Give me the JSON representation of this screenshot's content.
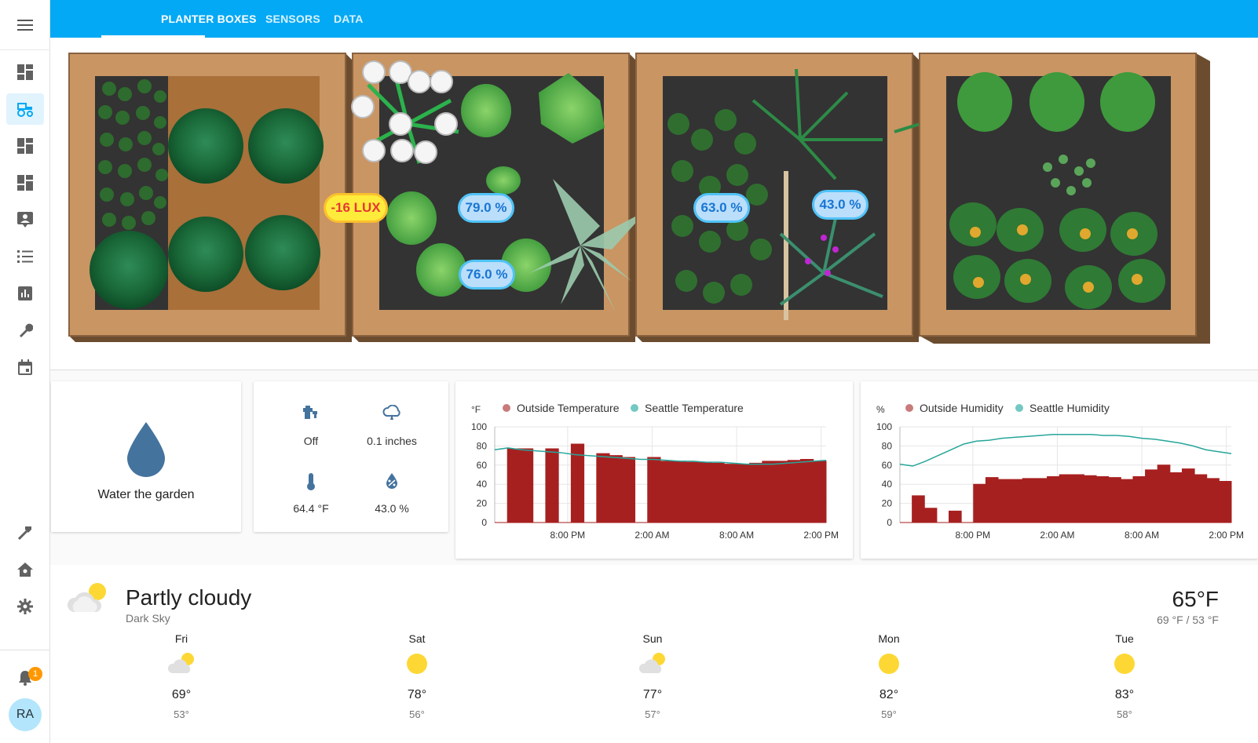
{
  "tabs": [
    {
      "label": "PLANTER BOXES",
      "active": true
    },
    {
      "label": "SENSORS",
      "active": false
    },
    {
      "label": "DATA",
      "active": false
    }
  ],
  "sidebar": {
    "items": [
      {
        "icon": "dashboard-icon"
      },
      {
        "icon": "tractor-icon",
        "active": true
      },
      {
        "icon": "dashboard-icon"
      },
      {
        "icon": "dashboard-icon"
      },
      {
        "icon": "account-box-icon"
      },
      {
        "icon": "list-icon"
      },
      {
        "icon": "chart-bar-icon"
      },
      {
        "icon": "wrench-icon"
      },
      {
        "icon": "calendar-icon"
      }
    ],
    "bottom_items": [
      {
        "icon": "hammer-icon"
      },
      {
        "icon": "home-assistant-icon"
      },
      {
        "icon": "gear-icon"
      }
    ],
    "notifications_count": "1",
    "user_initials": "RA"
  },
  "garden": {
    "sensors": {
      "lux": "-16 LUX",
      "moisture_1": "79.0 %",
      "moisture_2": "76.0 %",
      "moisture_3": "63.0 %",
      "moisture_4": "43.0 %"
    }
  },
  "water_card": {
    "label": "Water the garden"
  },
  "stats": {
    "valve": "Off",
    "rain": "0.1 inches",
    "temperature": "64.4 °F",
    "humidity": "43.0 %"
  },
  "chart_data": [
    {
      "type": "line",
      "ylabel": "°F",
      "ylim": [
        0,
        100
      ],
      "yticks": [
        "0",
        "20",
        "40",
        "60",
        "80",
        "100"
      ],
      "xticks": [
        "8:00 PM",
        "2:00 AM",
        "8:00 AM",
        "2:00 PM"
      ],
      "grid": true,
      "legend_position": "top-left",
      "series": [
        {
          "name": "Outside Temperature",
          "color": "#a31515",
          "values": [
            0,
            77,
            77,
            0,
            77,
            0,
            82,
            0,
            72,
            70,
            68,
            0,
            68,
            64,
            64,
            63,
            63,
            62,
            61,
            61,
            62,
            64,
            64,
            65,
            66,
            64
          ]
        },
        {
          "name": "Seattle Temperature",
          "color": "#26a69a",
          "values": [
            76,
            78,
            76,
            75,
            74,
            73,
            71,
            70,
            69,
            68,
            67,
            66,
            66,
            65,
            64,
            64,
            63,
            63,
            62,
            61,
            61,
            61,
            62,
            63,
            64,
            65
          ]
        }
      ]
    },
    {
      "type": "line",
      "ylabel": "%",
      "ylim": [
        0,
        100
      ],
      "yticks": [
        "0",
        "20",
        "40",
        "60",
        "80",
        "100"
      ],
      "xticks": [
        "8:00 PM",
        "2:00 AM",
        "8:00 AM",
        "2:00 PM"
      ],
      "grid": true,
      "legend_position": "top-left",
      "series": [
        {
          "name": "Outside Humidity",
          "color": "#a31515",
          "values": [
            0,
            28,
            15,
            0,
            12,
            0,
            40,
            47,
            45,
            45,
            46,
            46,
            48,
            50,
            50,
            49,
            48,
            47,
            45,
            48,
            55,
            60,
            52,
            56,
            50,
            46,
            43
          ]
        },
        {
          "name": "Seattle Humidity",
          "color": "#26a69a",
          "values": [
            61,
            59,
            64,
            70,
            76,
            82,
            85,
            86,
            88,
            89,
            90,
            91,
            92,
            92,
            92,
            92,
            91,
            91,
            90,
            88,
            87,
            85,
            83,
            80,
            76,
            74,
            72
          ]
        }
      ]
    }
  ],
  "weather": {
    "condition": "Partly cloudy",
    "source": "Dark Sky",
    "current_temp": "65°F",
    "high_low": "69 °F / 53 °F",
    "forecast": [
      {
        "day": "Fri",
        "icon": "partly-cloudy-icon",
        "high": "69°",
        "low": "53°"
      },
      {
        "day": "Sat",
        "icon": "sun-icon",
        "high": "78°",
        "low": "56°"
      },
      {
        "day": "Sun",
        "icon": "partly-cloudy-icon",
        "high": "77°",
        "low": "57°"
      },
      {
        "day": "Mon",
        "icon": "sun-icon",
        "high": "82°",
        "low": "59°"
      },
      {
        "day": "Tue",
        "icon": "sun-icon",
        "high": "83°",
        "low": "58°"
      }
    ]
  }
}
